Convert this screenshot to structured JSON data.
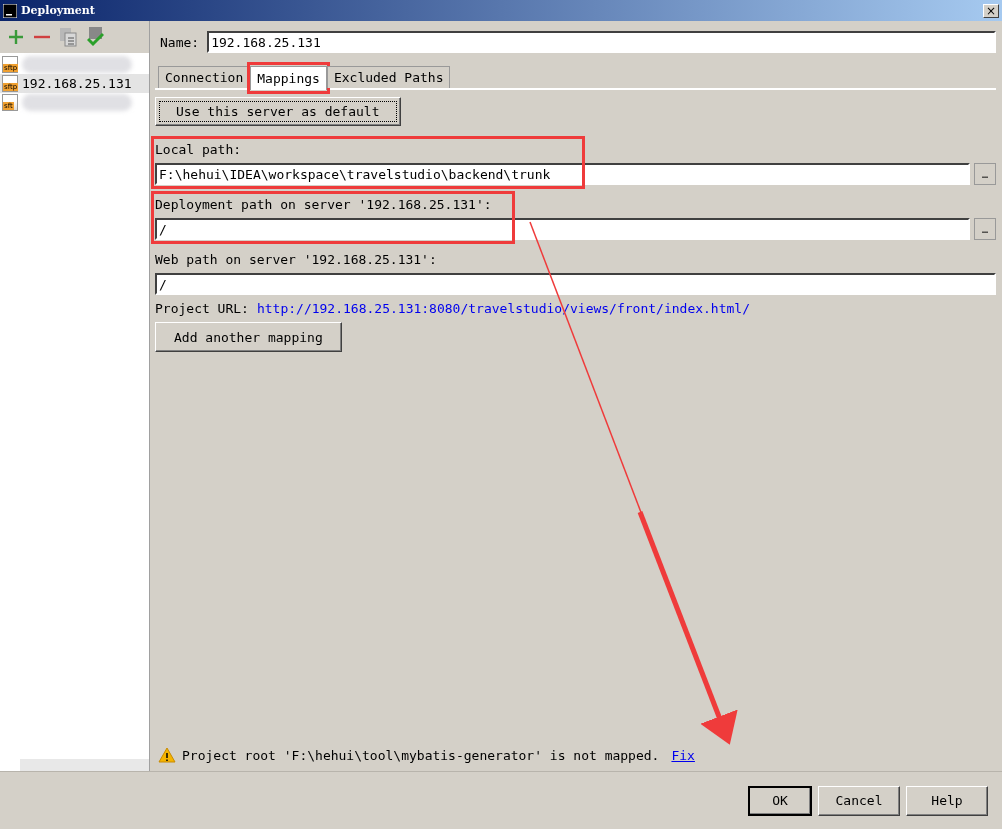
{
  "window": {
    "title": "Deployment",
    "close": "×"
  },
  "servers": [
    {
      "redacted": true,
      "selected": false,
      "icon": "sftp"
    },
    {
      "label": "192.168.25.131",
      "redacted": false,
      "selected": true,
      "icon": "sftp"
    },
    {
      "redacted": true,
      "selected": false,
      "icon": "sft"
    }
  ],
  "name_field": {
    "label": "Name:",
    "value": "192.168.25.131"
  },
  "tabs": [
    {
      "label": "Connection",
      "selected": false,
      "highlighted": false
    },
    {
      "label": "Mappings",
      "selected": true,
      "highlighted": true
    },
    {
      "label": "Excluded Paths",
      "selected": false,
      "highlighted": false
    }
  ],
  "default_button": "Use this server as default",
  "mappings": [
    {
      "label": "Local path:",
      "value": "F:\\hehui\\IDEA\\workspace\\travelstudio\\backend\\trunk",
      "browse": "…",
      "highlighted": true
    },
    {
      "label": "Deployment path on server '192.168.25.131':",
      "value": "/",
      "browse": "…",
      "highlighted": true
    },
    {
      "label": "Web path on server '192.168.25.131':",
      "value": "/",
      "highlighted": false
    }
  ],
  "project_url": {
    "label": "Project URL:",
    "url": "http://192.168.25.131:8080/travelstudio/views/front/index.html/"
  },
  "add_mapping_button": "Add another mapping",
  "warning": {
    "text": "Project root 'F:\\hehui\\tool\\mybatis-generator' is not mapped.",
    "link": "Fix"
  },
  "buttons": [
    {
      "label": "OK",
      "default": true
    },
    {
      "label": "Cancel",
      "default": false
    },
    {
      "label": "Help",
      "default": false
    }
  ]
}
